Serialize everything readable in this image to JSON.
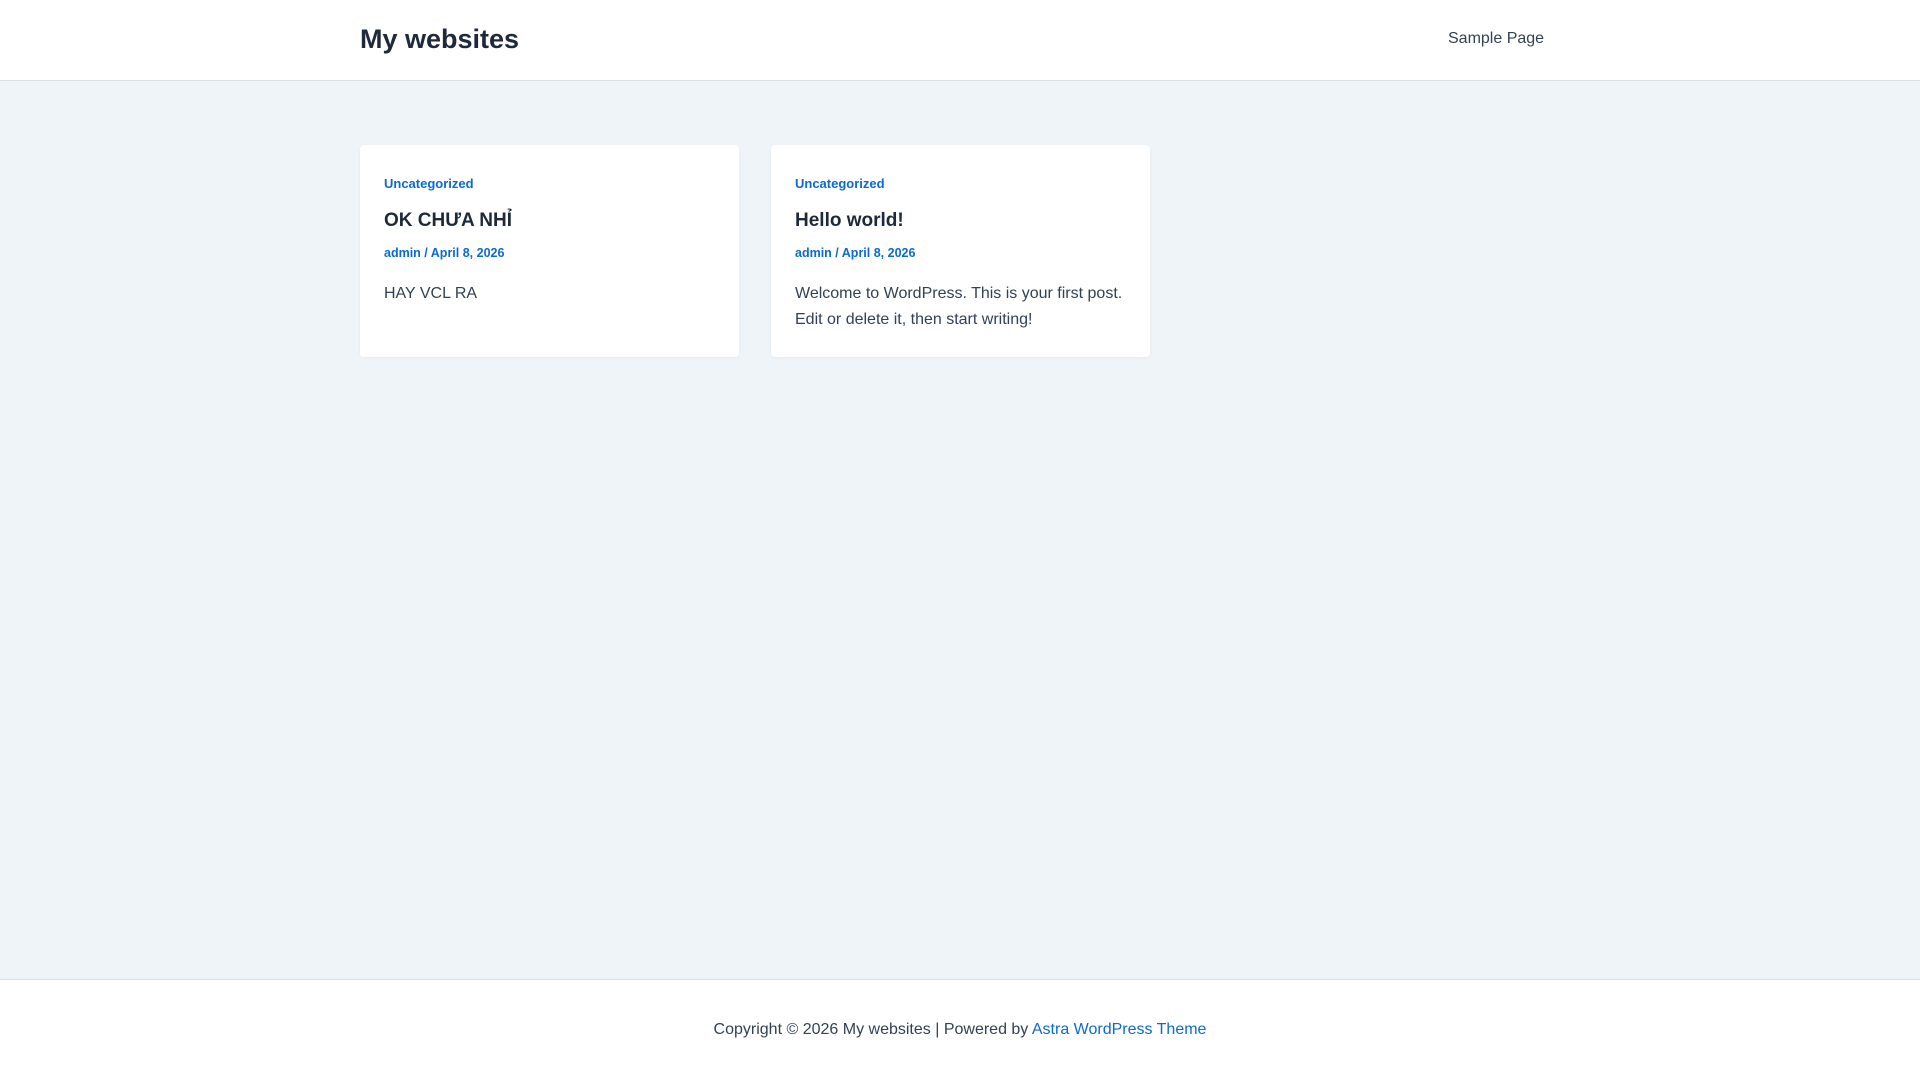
{
  "header": {
    "site_title": "My websites",
    "nav": [
      {
        "label": "Sample Page"
      }
    ]
  },
  "posts": [
    {
      "category": "Uncategorized",
      "title": "OK CHƯA NHỈ",
      "author": "admin",
      "separator": " / ",
      "date": "April 8, 2026",
      "excerpt": "HAY VCL RA"
    },
    {
      "category": "Uncategorized",
      "title": "Hello world!",
      "author": "admin",
      "separator": " / ",
      "date": "April 8, 2026",
      "excerpt": "Welcome to WordPress. This is your first post. Edit or delete it, then start writing!"
    }
  ],
  "footer": {
    "copyright": "Copyright © 2026 My websites | Powered by ",
    "theme_link": "Astra WordPress Theme"
  },
  "colors": {
    "accent": "#0b6ad1",
    "background": "#eff4f8",
    "heading": "#1e293b",
    "text": "#334155"
  }
}
